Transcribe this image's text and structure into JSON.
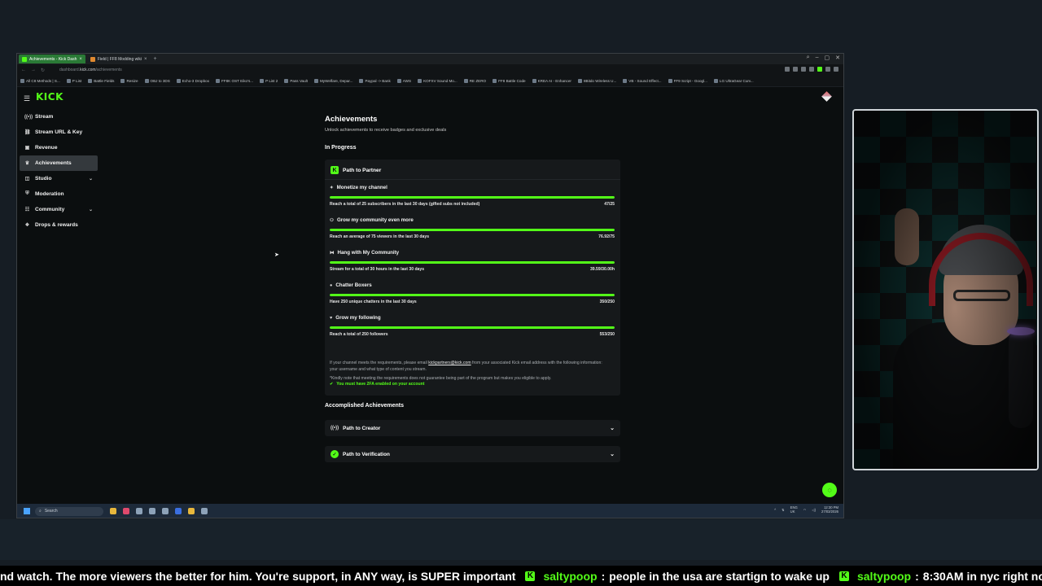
{
  "browser": {
    "tabs": [
      {
        "label": "Achievements - Kick Dash",
        "active": true
      },
      {
        "label": "Field | FF8 Modding wiki",
        "active": false
      }
    ],
    "new_tab": "+",
    "address": {
      "prefix": "dashboard.",
      "domain": "kick.com",
      "path": "/achievements"
    },
    "bookmarks": [
      "All C8 Methods | S...",
      "P List",
      "Battle Fields",
      "Resize",
      "OBJ to 3DS",
      "Echo-3 Dropbox",
      "FF8K OST Eiko's...",
      "P List 2",
      "Pass Vault",
      "MyWelfare, Depar...",
      "Paypal -> Bank",
      "AWS",
      "KOFXV Sound Mo...",
      "RE ZERO",
      "FF8 Battle Code",
      "KREA AI - Enhancer",
      "8Bitdo Wireless U...",
      "VB - Sound Effect...",
      "FF9 Script - Googl...",
      "LG UltraGear Curv..."
    ]
  },
  "sidebar": {
    "logo": "KICK",
    "items": [
      {
        "label": "Stream",
        "icon": "broadcast-icon",
        "glyph": "((•))",
        "expandable": false,
        "active": false
      },
      {
        "label": "Stream URL & Key",
        "icon": "link-icon",
        "glyph": "⛓",
        "expandable": false,
        "active": false
      },
      {
        "label": "Revenue",
        "icon": "dollar-icon",
        "glyph": "▣",
        "expandable": false,
        "active": false
      },
      {
        "label": "Achievements",
        "icon": "trophy-icon",
        "glyph": "♛",
        "expandable": false,
        "active": true
      },
      {
        "label": "Studio",
        "icon": "studio-icon",
        "glyph": "◫",
        "expandable": true,
        "active": false
      },
      {
        "label": "Moderation",
        "icon": "shield-icon",
        "glyph": "⛨",
        "expandable": false,
        "active": false
      },
      {
        "label": "Community",
        "icon": "community-icon",
        "glyph": "☷",
        "expandable": true,
        "active": false
      },
      {
        "label": "Drops & rewards",
        "icon": "gift-icon",
        "glyph": "❖",
        "expandable": false,
        "active": false
      }
    ]
  },
  "page": {
    "title": "Achievements",
    "subtitle": "Unlock achievements to receive badges and exclusive deals",
    "in_progress_heading": "In Progress",
    "partner_card": {
      "title": "Path to Partner",
      "goals": [
        {
          "title": "Monetize my channel",
          "icon": "sparkle-icon",
          "glyph": "✦",
          "desc": "Reach a total of 25 subscribers in the last 30 days (gifted subs not included)",
          "value": "47/25",
          "progress": 1.0
        },
        {
          "title": "Grow my community even more",
          "icon": "people-icon",
          "glyph": "⚇",
          "desc": "Reach an average of 75 viewers in the last 30 days",
          "value": "76.92/75",
          "progress": 1.0
        },
        {
          "title": "Hang with My Community",
          "icon": "controller-icon",
          "glyph": "⧓",
          "desc": "Stream for a total of 30 hours in the last 30 days",
          "value": "39.59/30.00h",
          "progress": 1.0
        },
        {
          "title": "Chatter Boxers",
          "icon": "chat-icon",
          "glyph": "●",
          "desc": "Have 250 unique chatters in the last 30 days",
          "value": "350/250",
          "progress": 1.0
        },
        {
          "title": "Grow my following",
          "icon": "heart-icon",
          "glyph": "♥",
          "desc": "Reach a total of 250 followers",
          "value": "553/250",
          "progress": 1.0
        }
      ],
      "note_before_link": "If your channel meets the requirements, please email ",
      "note_link": "kickpartners@kick.com",
      "note_after_link": " from your associated Kick email address with the following information: your username and what type of content you stream.",
      "note_disclaimer": "*Kindly note that meeting the requirements does not guarantee being part of the program but makes you eligible to apply.",
      "twofa": "You must have 2FA enabled on your account"
    },
    "accomplished_heading": "Accomplished Achievements",
    "accomplished": [
      {
        "title": "Path to Creator",
        "icon": "broadcast-icon",
        "glyph": "((•))"
      },
      {
        "title": "Path to Verification",
        "icon": "verified-badge-icon",
        "glyph": "✓"
      }
    ]
  },
  "taskbar": {
    "search_placeholder": "Search",
    "lang": "ENG",
    "region": "UK",
    "time": "12:30 PM",
    "date": "27/03/2026"
  },
  "ticker": {
    "lead_text": "nd watch. The more viewers the better for him. You're support, in ANY way, is SUPER important",
    "messages": [
      {
        "user": "saltypoop",
        "text": "people in the usa are startign to wake up"
      },
      {
        "user": "saltypoop",
        "text": "8:30AM in nyc right now"
      }
    ]
  },
  "colors": {
    "accent": "#53fc18",
    "background": "#0b0e0f",
    "card": "#16191b",
    "active_item": "#34393d"
  }
}
